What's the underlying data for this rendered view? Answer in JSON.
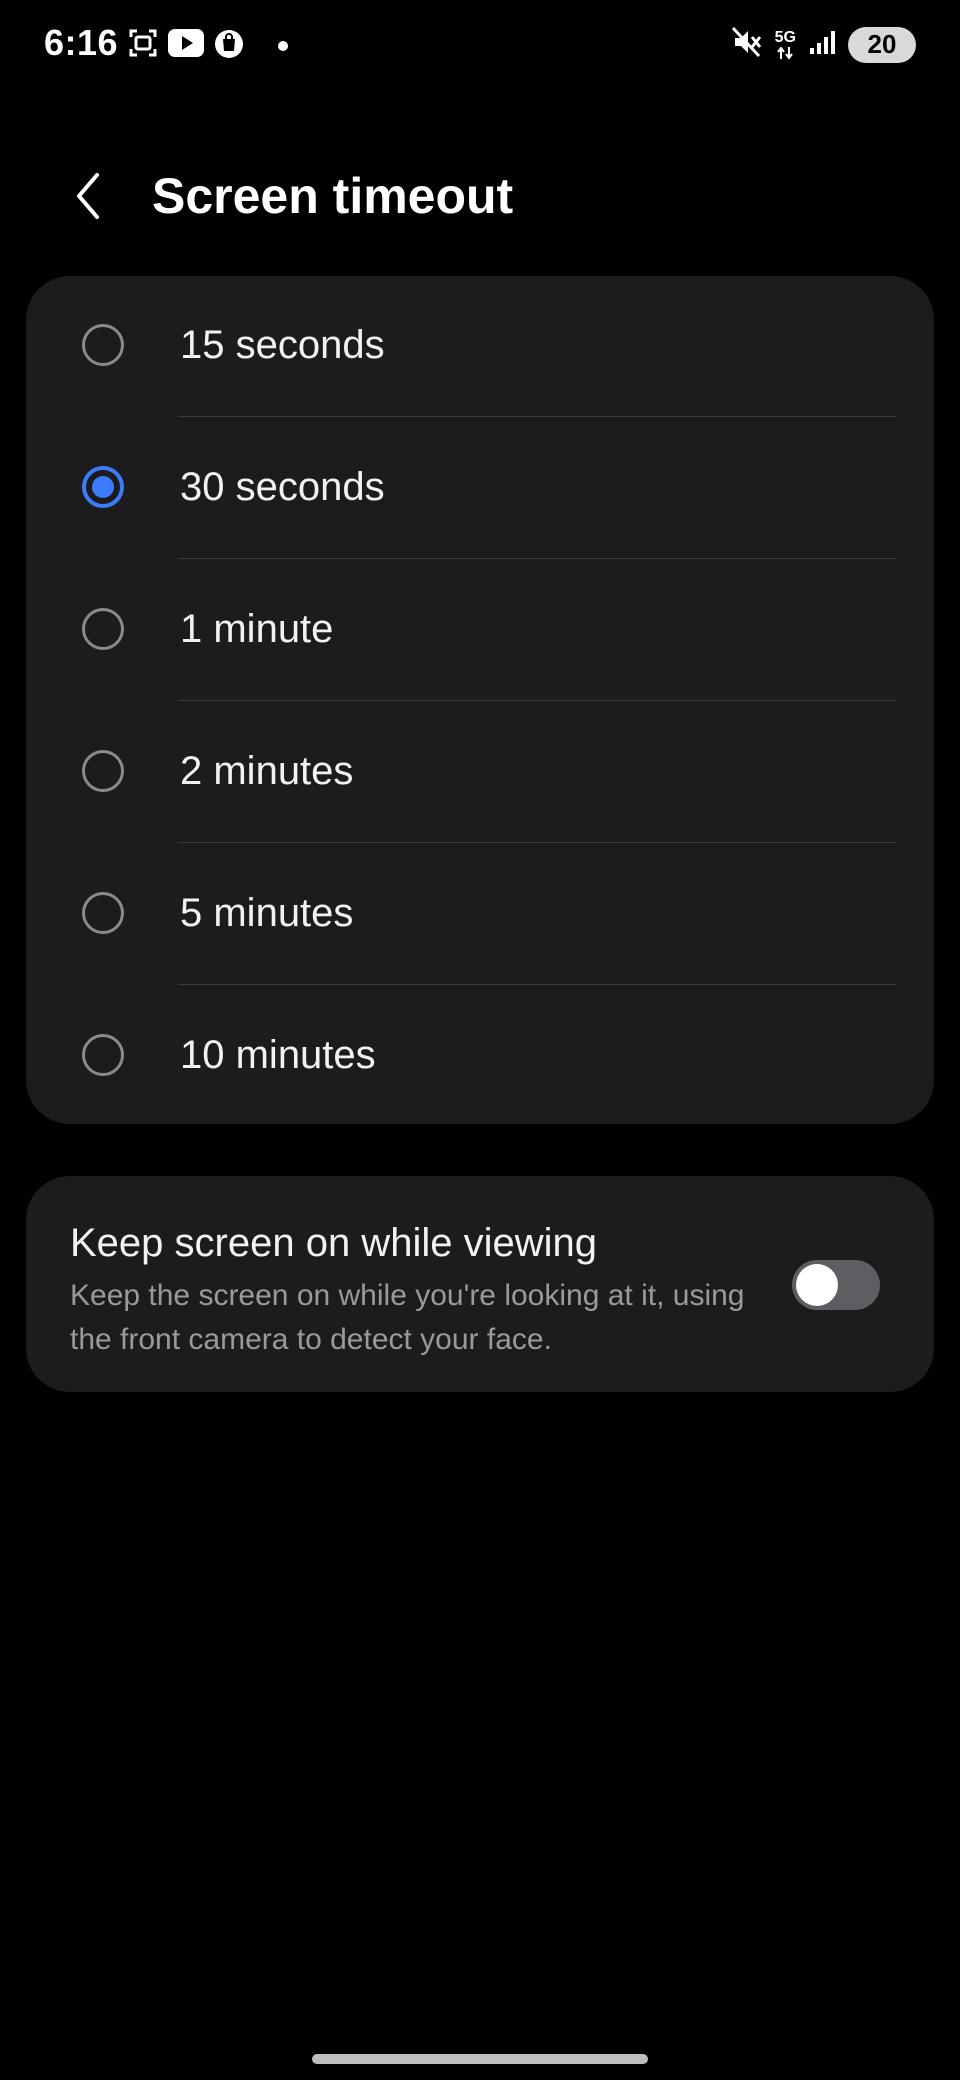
{
  "status_bar": {
    "time": "6:16",
    "network": "5G",
    "battery": "20",
    "icons": [
      "screenshot-icon",
      "youtube-icon",
      "shopping-bag-icon",
      "notification-dot",
      "mute-icon",
      "signal-icon"
    ]
  },
  "header": {
    "title": "Screen timeout",
    "back_icon": "chevron-left-icon"
  },
  "options": [
    {
      "label": "15 seconds",
      "selected": false
    },
    {
      "label": "30 seconds",
      "selected": true
    },
    {
      "label": "1 minute",
      "selected": false
    },
    {
      "label": "2 minutes",
      "selected": false
    },
    {
      "label": "5 minutes",
      "selected": false
    },
    {
      "label": "10 minutes",
      "selected": false
    }
  ],
  "keep_screen_on": {
    "title": "Keep screen on while viewing",
    "description": "Keep the screen on while you're looking at it, using the front camera to detect your face.",
    "enabled": false
  },
  "colors": {
    "accent": "#3e7bfa",
    "card_background": "#1c1c1e",
    "background": "#000000"
  }
}
